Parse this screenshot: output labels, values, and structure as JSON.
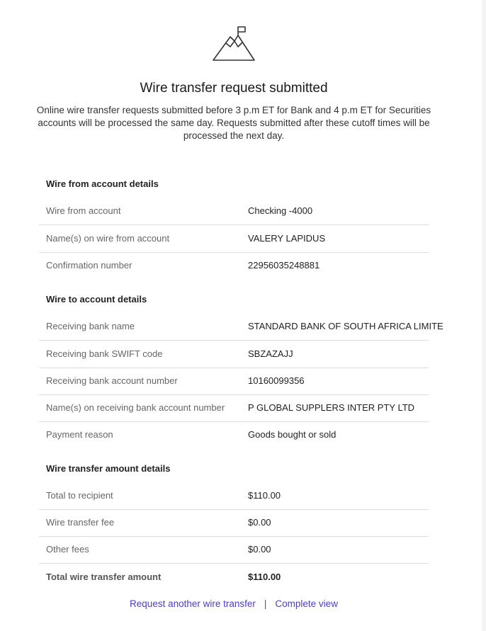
{
  "icon": "mountain-flag-icon",
  "title": "Wire transfer request submitted",
  "notice": "Online wire transfer requests submitted before 3 p.m ET for Bank and 4 p.m ET for Securities accounts will be processed the same day. Requests submitted after these cutoff times will be processed the next day.",
  "from_section": {
    "heading": "Wire from account details",
    "rows": [
      {
        "label": "Wire from account",
        "value": "Checking -4000"
      },
      {
        "label": "Name(s) on wire from account",
        "value": "VALERY LAPIDUS"
      },
      {
        "label": "Confirmation number",
        "value": "22956035248881"
      }
    ]
  },
  "to_section": {
    "heading": "Wire to account details",
    "rows": [
      {
        "label": "Receiving bank name",
        "value": "STANDARD BANK OF SOUTH AFRICA LIMITE"
      },
      {
        "label": "Receiving bank SWIFT code",
        "value": "SBZAZAJJ"
      },
      {
        "label": "Receiving bank account number",
        "value": "10160099356"
      },
      {
        "label": "Name(s) on receiving bank account number",
        "value": "P GLOBAL SUPPLERS INTER PTY LTD"
      },
      {
        "label": "Payment reason",
        "value": "Goods bought or sold"
      }
    ]
  },
  "amount_section": {
    "heading": "Wire transfer amount details",
    "rows": [
      {
        "label": "Total to recipient",
        "value": "$110.00"
      },
      {
        "label": "Wire transfer fee",
        "value": "$0.00"
      },
      {
        "label": "Other fees",
        "value": "$0.00"
      },
      {
        "label": "Total wire transfer amount",
        "value": "$110.00"
      }
    ]
  },
  "footer": {
    "another_link": "Request another wire transfer",
    "separator": "|",
    "complete_link": "Complete view"
  },
  "colors": {
    "link": "#4a3ec2",
    "divider": "#dcdcdc"
  }
}
